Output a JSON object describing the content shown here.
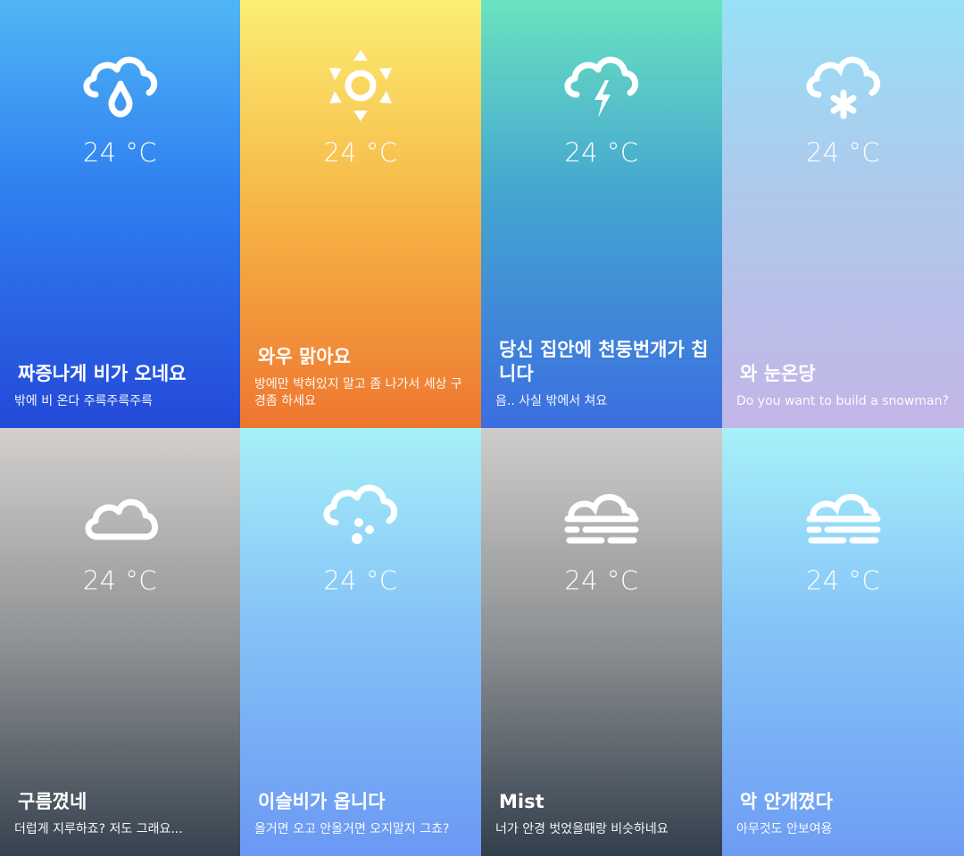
{
  "cards": [
    {
      "icon": "rain-cloud-icon",
      "temp": "24 °C",
      "title": "짜증나게 비가 오네요",
      "subtitle": "밖에 비 온다 주륵주륵주륵"
    },
    {
      "icon": "sun-icon",
      "temp": "24 °C",
      "title": "와우 맑아요",
      "subtitle": "방에만 박혀있지 말고 좀 나가서 세상 구경좀 하세요"
    },
    {
      "icon": "thunderstorm-icon",
      "temp": "24 °C",
      "title": "당신 집안에 천둥번개가 칩니다",
      "subtitle": "음.. 사실 밖에서 쳐요"
    },
    {
      "icon": "snow-cloud-icon",
      "temp": "24 °C",
      "title": "와 눈온당",
      "subtitle": "Do you want to build a snowman?"
    },
    {
      "icon": "cloud-icon",
      "temp": "24 °C",
      "title": "구름꼈네",
      "subtitle": "더럽게 지루하죠? 저도 그래요..."
    },
    {
      "icon": "drizzle-cloud-icon",
      "temp": "24 °C",
      "title": "이슬비가 옵니다",
      "subtitle": "올거면 오고 안올거면 오지말지 그쵸?"
    },
    {
      "icon": "mist-icon",
      "temp": "24 °C",
      "title": "Mist",
      "subtitle": "너가 안경 벗었을때랑 비슷하네요"
    },
    {
      "icon": "haze-icon",
      "temp": "24 °C",
      "title": "악 안개꼈다",
      "subtitle": "아무것도 안보여용"
    }
  ],
  "colors": {
    "text": "#ffffff",
    "rain": [
      "#4fb6f5",
      "#2449d8"
    ],
    "clear": [
      "#fbef73",
      "#ee7630"
    ],
    "thunder": [
      "#6ae3c0",
      "#3b6ee0"
    ],
    "snow": [
      "#97e0f8",
      "#c3b5e7"
    ],
    "clouds": [
      "#d3d0cd",
      "#36424e"
    ],
    "drizzle": [
      "#a6f0f8",
      "#6b98f4"
    ],
    "mist": [
      "#cfcdcb",
      "#323f4c"
    ],
    "haze": [
      "#a6f1f9",
      "#6e9cf4"
    ]
  }
}
